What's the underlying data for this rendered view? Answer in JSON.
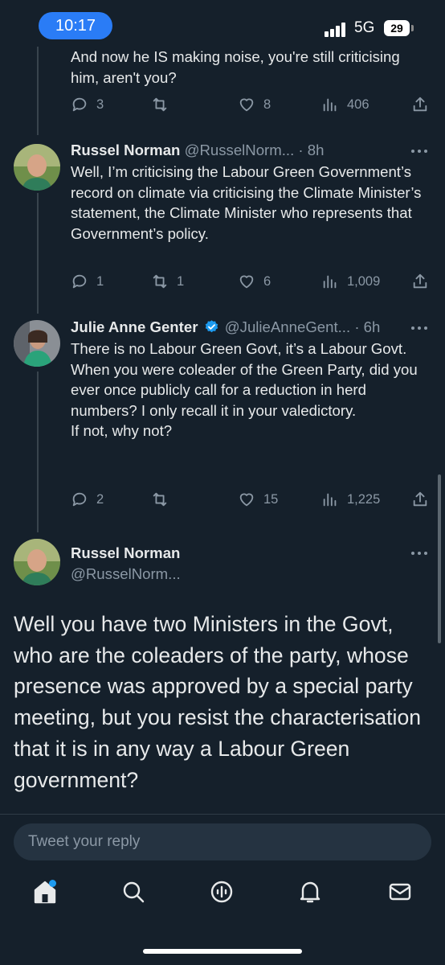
{
  "status_bar": {
    "time": "10:17",
    "network": "5G",
    "battery": "29"
  },
  "tweets": [
    {
      "text": "And now he IS making noise, you're still criticising him, aren't you?",
      "stats": {
        "replies": "3",
        "retweets": "",
        "likes": "8",
        "views": "406"
      }
    },
    {
      "name": "Russel Norman",
      "handle": "@RusselNorm...",
      "time": "· 8h",
      "text": "Well, I’m criticising the Labour Green Government’s record on climate via criticising the Climate Minister’s statement, the Climate Minister who represents that Government’s policy.",
      "stats": {
        "replies": "1",
        "retweets": "1",
        "likes": "6",
        "views": "1,009"
      }
    },
    {
      "name": "Julie Anne Genter",
      "handle": "@JulieAnneGent...",
      "time": "· 6h",
      "verified": true,
      "text_lines": [
        "There is no Labour Green Govt, it’s a Labour Govt.",
        "When you were coleader of the Green Party, did you ever once publicly call for a reduction in herd numbers? I only recall it in your valedictory.",
        "If not, why not?"
      ],
      "stats": {
        "replies": "2",
        "retweets": "",
        "likes": "15",
        "views": "1,225"
      }
    }
  ],
  "main_tweet": {
    "name": "Russel Norman",
    "handle": "@RusselNorm...",
    "text": "Well you have two Ministers in the Govt, who are the coleaders of the party, whose presence was approved by a special party meeting, but you resist the characterisation that it is in any way a Labour Green government?"
  },
  "reply": {
    "placeholder": "Tweet your reply"
  },
  "colors": {
    "background": "#15202b",
    "accent": "#1d9bf0",
    "muted": "#8b98a5",
    "time_pill": "#2a7cf6"
  },
  "icons": [
    "reply-icon",
    "retweet-icon",
    "like-icon",
    "views-icon",
    "share-icon",
    "more-icon",
    "verified-icon",
    "home-icon",
    "search-icon",
    "spaces-icon",
    "notifications-icon",
    "messages-icon"
  ]
}
